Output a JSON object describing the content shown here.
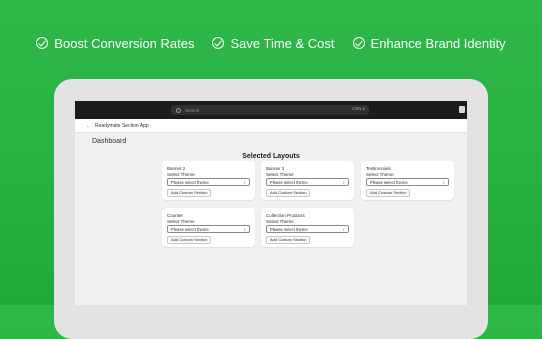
{
  "features": [
    {
      "label": "Boost Conversion Rates",
      "icon": "check-circle-icon"
    },
    {
      "label": "Save Time & Cost",
      "icon": "check-circle-icon"
    },
    {
      "label": "Enhance Brand Identity",
      "icon": "check-circle-icon"
    }
  ],
  "colors": {
    "background": "#28b243",
    "topbar": "#1b1b1b",
    "screen": "#f1f1f1"
  },
  "admin": {
    "search_placeholder": "Search",
    "shortcut": "CTRL K",
    "app_name": "Readymate Section App",
    "page_title": "Dashboard",
    "section_title": "Selected Layouts"
  },
  "cards": [
    {
      "name": "Banner 2",
      "select_label": "Select Theme",
      "select_value": "Please select theme",
      "button": "Add Custom Section"
    },
    {
      "name": "Banner 3",
      "select_label": "Select Theme",
      "select_value": "Please select theme",
      "button": "Add Custom Section"
    },
    {
      "name": "Testimonials",
      "select_label": "Select Theme",
      "select_value": "Please select theme",
      "button": "Add Custom Section"
    },
    {
      "name": "Counter",
      "select_label": "Select Theme",
      "select_value": "Please select theme",
      "button": "Add Custom Section"
    },
    {
      "name": "Collection Products",
      "select_label": "Select Theme",
      "select_value": "Please select theme",
      "button": "Add Custom Section"
    }
  ]
}
